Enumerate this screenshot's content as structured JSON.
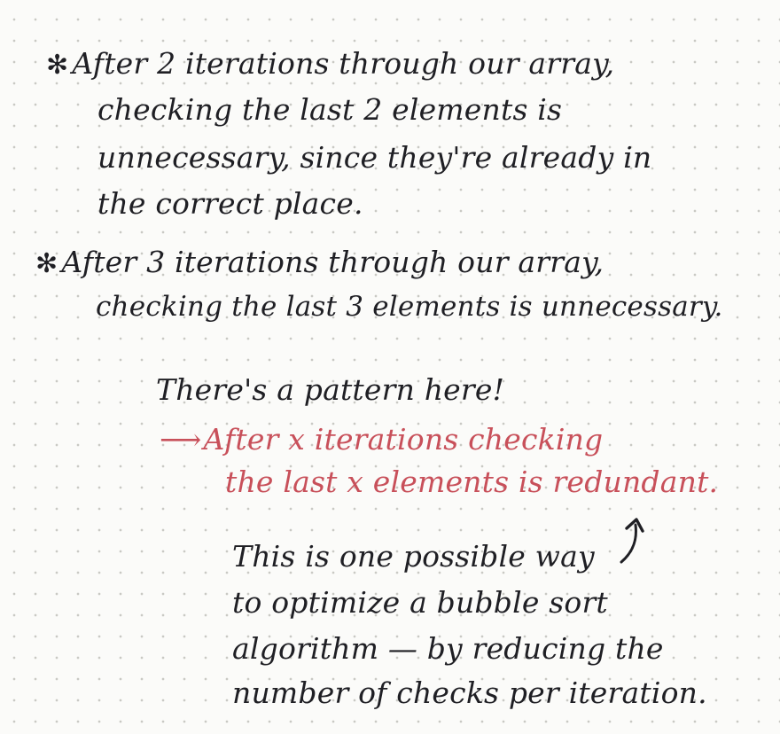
{
  "note": {
    "block1": {
      "bullet": "✻",
      "lines": [
        "After 2 iterations through our array,",
        "checking the last 2 elements is",
        "unnecessary, since they're already in",
        "the correct place."
      ]
    },
    "block2": {
      "bullet": "✻",
      "lines": [
        "After 3 iterations through our array,",
        "checking the last 3 elements is unnecessary."
      ]
    },
    "pattern": {
      "heading": "There's a pattern here!",
      "arrow": "⟶",
      "lines": [
        "After x iterations checking",
        "the last x elements is redundant."
      ]
    },
    "conclusion": {
      "lines": [
        "This is one possible way",
        "to optimize a bubble sort",
        "algorithm — by reducing the",
        "number of checks per iteration."
      ]
    },
    "colors": {
      "ink": "#1f1f24",
      "red_ink": "#c8505a",
      "paper": "#fbfbf9",
      "dot_grid": "#c9c9c4"
    }
  }
}
